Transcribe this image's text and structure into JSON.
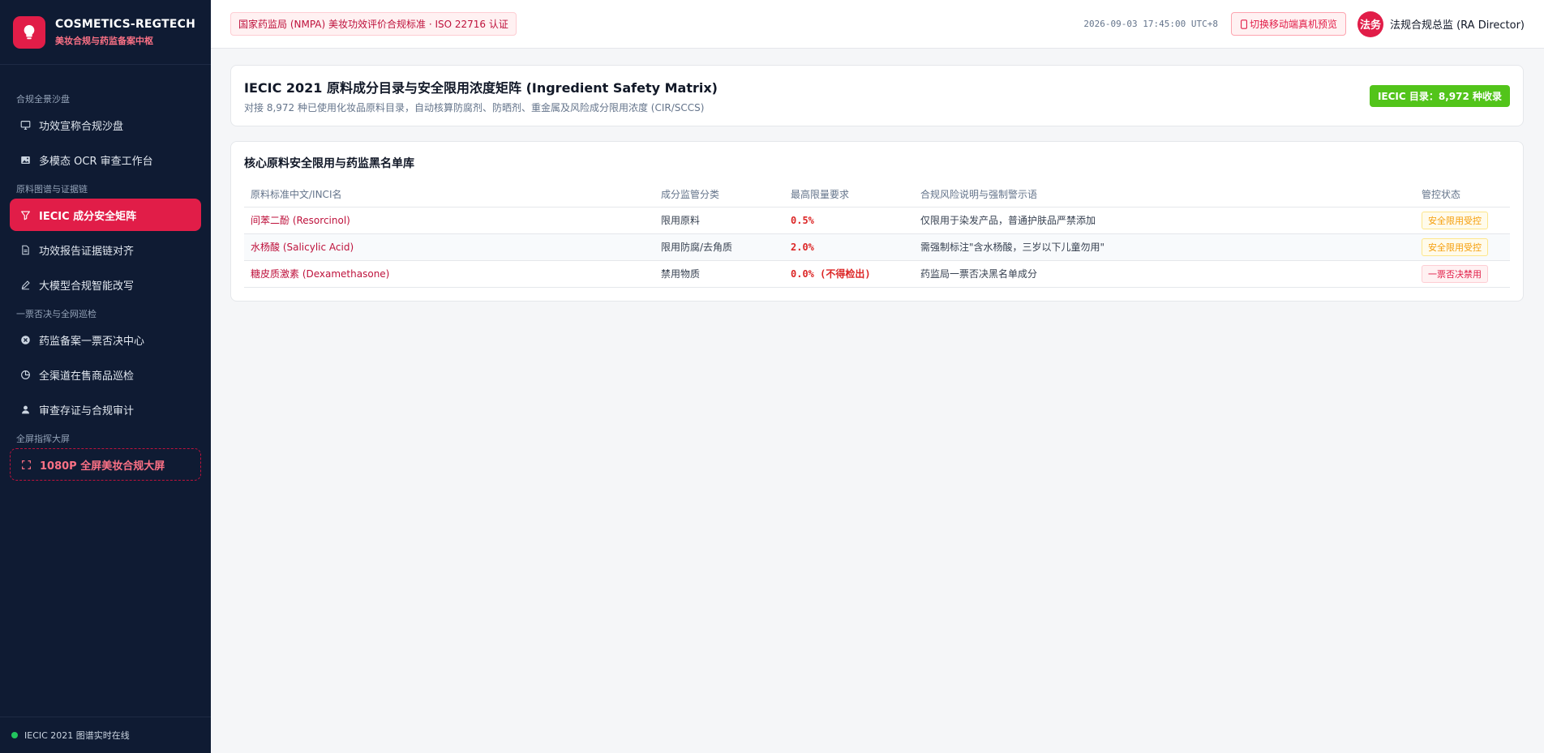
{
  "brand": {
    "title": "COSMETICS-REGTECH",
    "subtitle": "美妆合规与药监备案中枢"
  },
  "sidebar": {
    "sections": [
      {
        "label": "合规全景沙盘",
        "items": [
          {
            "label": "功效宣称合规沙盘",
            "icon": "monitor-icon"
          },
          {
            "label": "多模态 OCR 审查工作台",
            "icon": "image-icon"
          }
        ]
      },
      {
        "label": "原料图谱与证据链",
        "items": [
          {
            "label": "IECIC 成分安全矩阵",
            "icon": "filter-icon",
            "active": true
          },
          {
            "label": "功效报告证据链对齐",
            "icon": "document-icon"
          },
          {
            "label": "大模型合规智能改写",
            "icon": "pen-icon"
          }
        ]
      },
      {
        "label": "一票否决与全网巡检",
        "items": [
          {
            "label": "药监备案一票否决中心",
            "icon": "x-circle-icon"
          },
          {
            "label": "全渠道在售商品巡检",
            "icon": "pie-icon"
          },
          {
            "label": "审查存证与合规审计",
            "icon": "user-icon"
          }
        ]
      },
      {
        "label": "全屏指挥大屏",
        "items": [
          {
            "label": "1080P 全屏美妆合规大屏",
            "icon": "fullscreen-icon"
          }
        ]
      }
    ],
    "footer": "IECIC 2021 图谱实时在线"
  },
  "header": {
    "cert_badge": "国家药监局 (NMPA) 美妆功效评价合规标准 · ISO 22716 认证",
    "timestamp": "2026-09-03 17:45:00 UTC+8",
    "mobile_button": "切换移动端真机预览",
    "avatar_text": "法务",
    "user_name": "法规合规总监 (RA Director)"
  },
  "summary": {
    "title": "IECIC 2021 原料成分目录与安全限用浓度矩阵 (Ingredient Safety Matrix)",
    "subtitle": "对接 8,972 种已使用化妆品原料目录，自动核算防腐剂、防晒剂、重金属及风险成分限用浓度 (CIR/SCCS)",
    "count_badge": "IECIC 目录：8,972 种收录"
  },
  "table": {
    "title": "核心原料安全限用与药监黑名单库",
    "columns": [
      "原料标准中文/INCI名",
      "成分监管分类",
      "最高限量要求",
      "合规风险说明与强制警示语",
      "管控状态"
    ],
    "rows": [
      {
        "name": "间苯二酚 (Resorcinol)",
        "category": "限用原料",
        "limit": "0.5%",
        "note": "仅限用于染发产品，普通护肤品严禁添加",
        "status": "安全限用受控",
        "status_color": "#f59e0b"
      },
      {
        "name": "水杨酸 (Salicylic Acid)",
        "category": "限用防腐/去角质",
        "limit": "2.0%",
        "note": "需强制标注\"含水杨酸，三岁以下儿童勿用\"",
        "status": "安全限用受控",
        "status_color": "#f59e0b"
      },
      {
        "name": "糖皮质激素 (Dexamethasone)",
        "category": "禁用物质",
        "limit": "0.0% (不得检出)",
        "note": "药监局一票否决黑名单成分",
        "status": "一票否决禁用",
        "status_color": "#e11d48"
      }
    ]
  }
}
